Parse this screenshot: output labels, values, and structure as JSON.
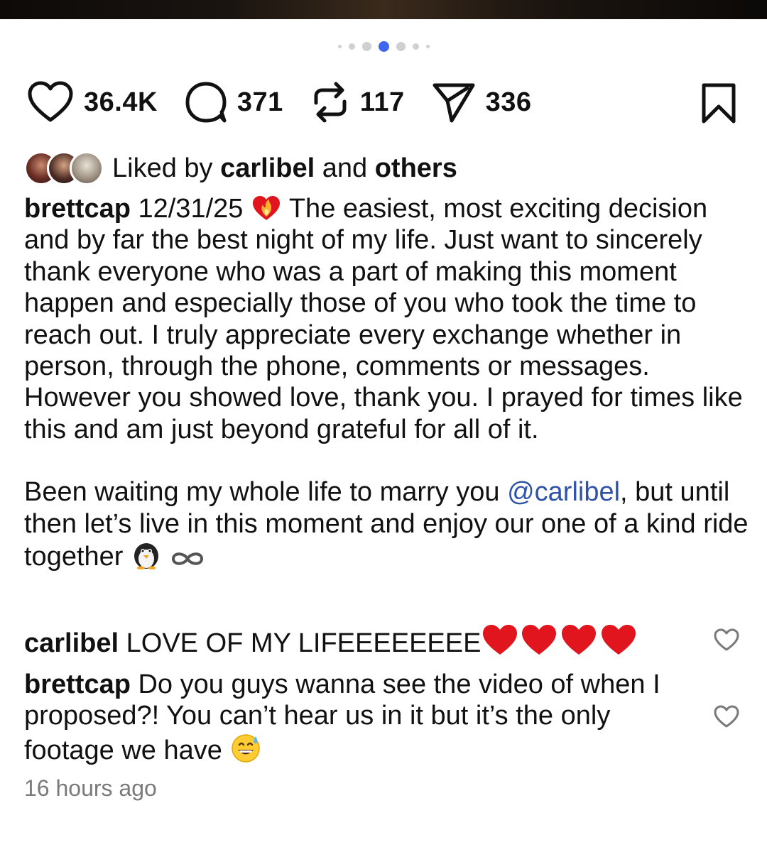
{
  "carousel": {
    "total": 7,
    "active_index": 3
  },
  "actions": {
    "like_count": "36.4K",
    "comment_count": "371",
    "repost_count": "117",
    "share_count": "336",
    "icons": [
      "heart-icon",
      "comment-icon",
      "repost-icon",
      "send-icon",
      "bookmark-icon"
    ]
  },
  "liked_by": {
    "prefix": "Liked by",
    "user": "carlibel",
    "conjunction": "and",
    "others": "others"
  },
  "caption": {
    "username": "brettcap",
    "date": "12/31/25",
    "text_1": "The easiest, most exciting decision and by far the best night of my life. Just want to sincerely thank everyone who was a part of making this moment happen and especially those of you who took the time to reach out. I truly appreciate every exchange whether in person, through the phone, comments or messages. However you showed love, thank you. I prayed for times like this and am just beyond grateful for all of it.",
    "text_2_before": "Been waiting my whole life to marry you",
    "mention": "@carlibel",
    "text_2_after": ", but until then let’s live in this moment and enjoy our one of a kind ride together"
  },
  "comments": [
    {
      "username": "carlibel",
      "text": "LOVE OF MY LIFEEEEEEEE"
    },
    {
      "username": "brettcap",
      "text": "Do you guys wanna see the video of when I proposed?! You can’t hear us in it but it’s the only footage we have"
    }
  ],
  "timestamp": "16 hours ago",
  "colors": {
    "accent": "#3f66f0",
    "mention": "#2f53a8",
    "muted": "#7a7a7a",
    "heart_red": "#e0151d"
  }
}
